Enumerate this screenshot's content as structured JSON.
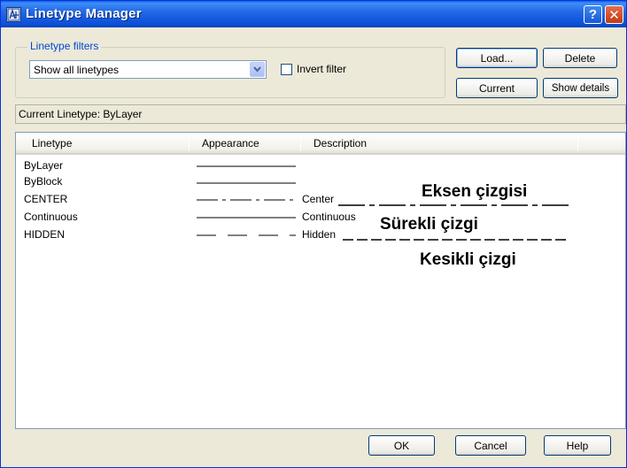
{
  "window": {
    "title": "Linetype Manager",
    "help_label": "?",
    "close_label": "✕"
  },
  "filters": {
    "group_title": "Linetype filters",
    "selected": "Show all linetypes",
    "invert_label": "Invert filter",
    "invert_checked": false
  },
  "buttons": {
    "load": "Load...",
    "delete": "Delete",
    "current": "Current",
    "show_details": "Show details",
    "ok": "OK",
    "cancel": "Cancel",
    "help": "Help"
  },
  "current_linetype": "Current Linetype:  ByLayer",
  "list": {
    "columns": [
      "Linetype",
      "Appearance",
      "Description"
    ],
    "rows": [
      {
        "name": "ByLayer",
        "appearance": "solid",
        "description": ""
      },
      {
        "name": "ByBlock",
        "appearance": "solid",
        "description": ""
      },
      {
        "name": "CENTER",
        "appearance": "center",
        "description": "Center"
      },
      {
        "name": "Continuous",
        "appearance": "solid",
        "description": "Continuous"
      },
      {
        "name": "HIDDEN",
        "appearance": "hidden",
        "description": "Hidden"
      }
    ]
  },
  "annotations": {
    "center": "Eksen çizgisi",
    "continuous": "Sürekli çizgi",
    "hidden": "Kesikli çizgi"
  }
}
